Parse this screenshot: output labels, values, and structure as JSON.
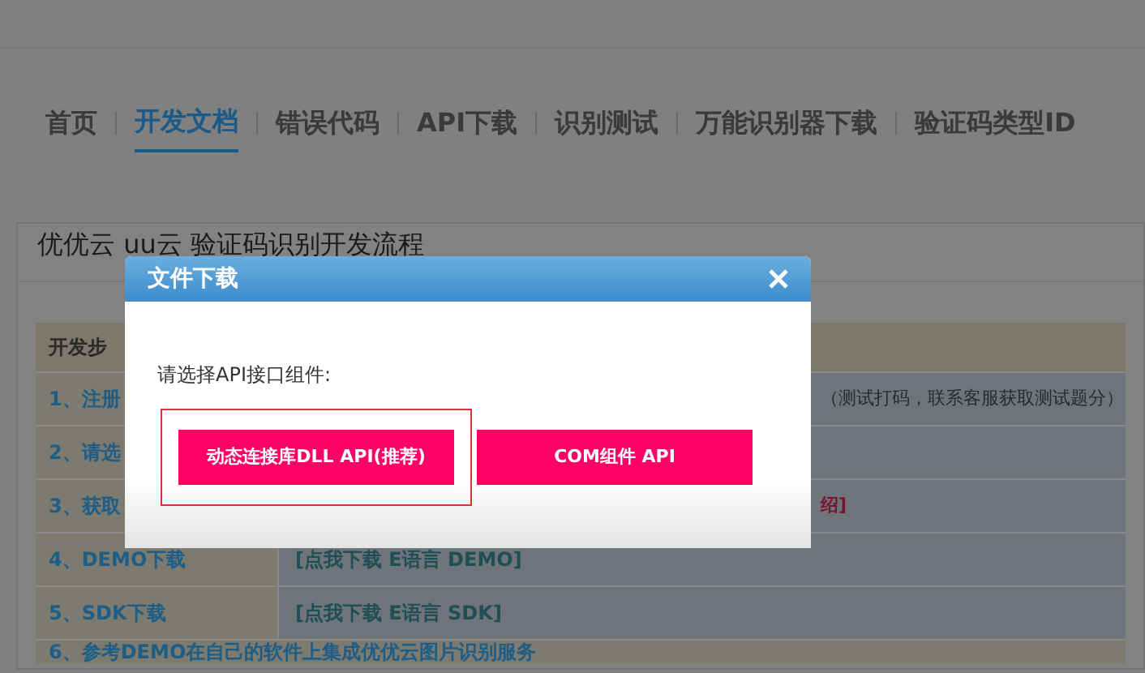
{
  "nav": [
    {
      "label": "首页",
      "selected": false
    },
    {
      "label": "开发文档",
      "selected": true
    },
    {
      "label": "错误代码",
      "selected": false
    },
    {
      "label": "API下载",
      "selected": false
    },
    {
      "label": "识别测试",
      "selected": false
    },
    {
      "label": "万能识别器下载",
      "selected": false
    },
    {
      "label": "验证码类型ID",
      "selected": false
    }
  ],
  "panel": {
    "title": "优优云 uu云 验证码识别开发流程",
    "table": {
      "header": "开发步",
      "rows": [
        {
          "step": "1、注册",
          "detail": "（测试打码，联系客服获取测试题分）",
          "kind": "far"
        },
        {
          "step": "2、请选",
          "kind": "plain"
        },
        {
          "step": "3、获取",
          "detail": "绍]",
          "kind": "far"
        },
        {
          "step": "4、DEMO下载",
          "detail": "[点我下载 E语言 DEMO]",
          "kind": "link"
        },
        {
          "step": "5、SDK下载",
          "detail": "[点我下载 E语言 SDK]",
          "kind": "link"
        }
      ],
      "footer_row": "6、参考DEMO在自己的软件上集成优优云图片识别服务"
    }
  },
  "dialog": {
    "title": "文件下载",
    "prompt": "请选择API接口组件:",
    "buttons": [
      {
        "label": "动态连接库DLL API(推荐)",
        "selected": true
      },
      {
        "label": "COM组件 API",
        "selected": false
      }
    ]
  }
}
